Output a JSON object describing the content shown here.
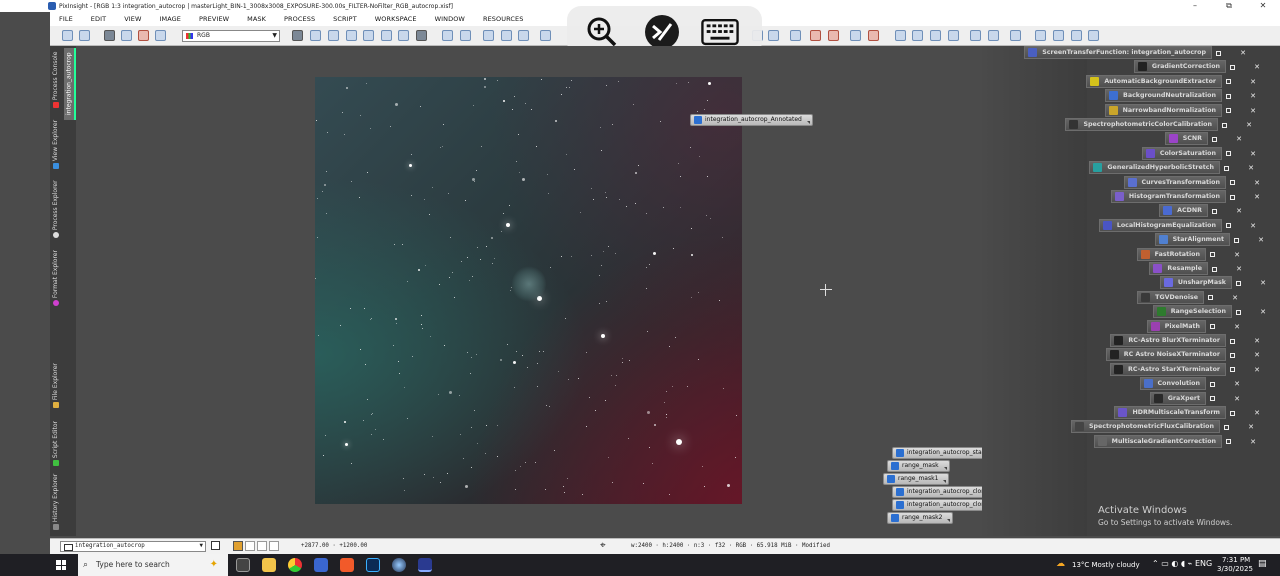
{
  "window": {
    "title": "PixInsight - [RGB 1:3 integration_autocrop | masterLight_BIN-1_3008x3008_EXPOSURE-300.00s_FILTER-NoFilter_RGB_autocrop.xisf]",
    "minimize": "–",
    "maximize": "⧉",
    "close": "✕"
  },
  "menu": [
    "FILE",
    "EDIT",
    "VIEW",
    "IMAGE",
    "PREVIEW",
    "MASK",
    "PROCESS",
    "SCRIPT",
    "WORKSPACE",
    "WINDOW",
    "RESOURCES"
  ],
  "toolbar": {
    "channel_select": "RGB"
  },
  "left_tabs": [
    "Process Console",
    "View Explorer",
    "Process Explorer",
    "Format Explorer",
    "File Explorer",
    "Script Editor",
    "History Explorer"
  ],
  "document_tab": "integration_autocrop",
  "image_icons": [
    "integration_autocrop_Annotated",
    "integration_autocrop_stars",
    "range_mask",
    "range_mask1",
    "integration_autocrop_clone_stars",
    "integration_autocrop_clone",
    "range_mask2"
  ],
  "process_icons": [
    "ScreenTransferFunction: integration_autocrop",
    "GradientCorrection",
    "AutomaticBackgroundExtractor",
    "BackgroundNeutralization",
    "NarrowbandNormalization",
    "SpectrophotometricColorCalibration",
    "SCNR",
    "ColorSaturation",
    "GeneralizedHyperbolicStretch",
    "CurvesTransformation",
    "HistogramTransformation",
    "ACDNR",
    "LocalHistogramEqualization",
    "StarAlignment",
    "FastRotation",
    "Resample",
    "UnsharpMask",
    "TGVDenoise",
    "RangeSelection",
    "PixelMath",
    "RC-Astro BlurXTerminator",
    "RC Astro NoiseXTerminator",
    "RC-Astro StarXTerminator",
    "Convolution",
    "GraXpert",
    "HDRMultiscaleTransform",
    "SpectrophotometricFluxCalibration",
    "MultiscaleGradientCorrection"
  ],
  "process_icon_colors": [
    "#4a5fc1",
    "#222222",
    "#d4c21b",
    "#3d6fd1",
    "#c9a52a",
    "#333333",
    "#9b44c8",
    "#6b4fc9",
    "#27a0a0",
    "#5a6fd0",
    "#7a5fc9",
    "#4a6ad1",
    "#4a55c4",
    "#5080d0",
    "#c06030",
    "#8a50c8",
    "#6a6ae0",
    "#3a3a3a",
    "#2e7b2e",
    "#9a40b0",
    "#222222",
    "#222222",
    "#222222",
    "#4a6fc8",
    "#2a2a2a",
    "#6a55c9",
    "#444444",
    "#666666"
  ],
  "status": {
    "view_select": "integration_autocrop",
    "coords": "+2877.00 · +1200.00",
    "info": "w:2400 · h:2400 · n:3 · f32 · RGB · 65.918 MiB · Modified"
  },
  "activate": {
    "title": "Activate Windows",
    "subtitle": "Go to Settings to activate Windows."
  },
  "taskbar": {
    "search_placeholder": "Type here to search",
    "weather": "13°C  Mostly cloudy",
    "time": "7:31 PM",
    "date": "3/30/2025"
  }
}
